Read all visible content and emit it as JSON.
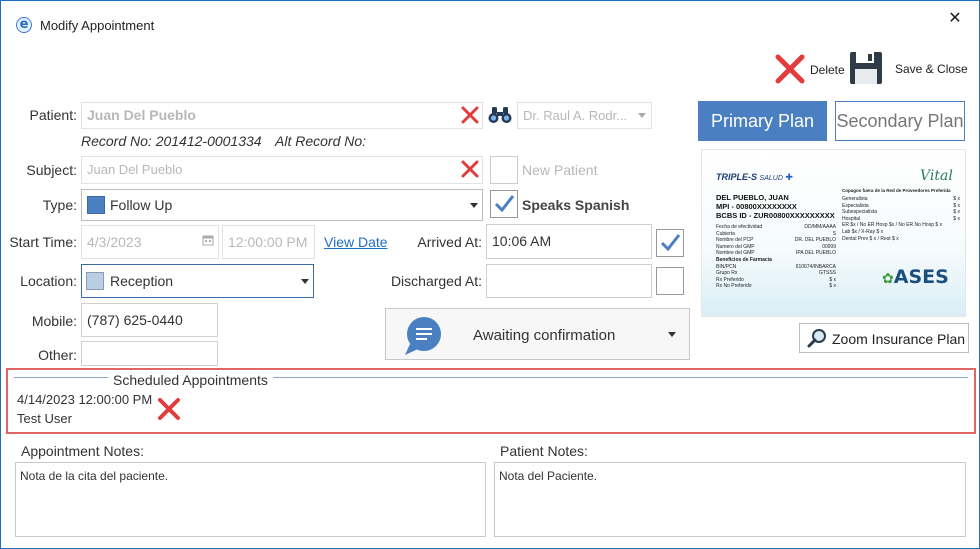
{
  "window": {
    "title": "Modify Appointment"
  },
  "toolbar": {
    "delete_label": "Delete",
    "save_close_label": "Save & Close"
  },
  "patient": {
    "label": "Patient:",
    "value": "Juan Del Pueblo",
    "record_no": "Record No: 201412-0001334",
    "alt_record_no": "Alt Record No:",
    "doctor": "Dr. Raul A. Rodr..."
  },
  "subject": {
    "label": "Subject:",
    "value": "Juan Del Pueblo",
    "new_patient_label": "New Patient"
  },
  "type": {
    "label": "Type:",
    "value": "Follow Up",
    "color": "#4a7fc1",
    "speaks_spanish_label": "Speaks Spanish"
  },
  "start_time": {
    "label": "Start Time:",
    "date": "4/3/2023",
    "time": "12:00:00 PM",
    "view_date_label": "View Date",
    "arrived_label": "Arrived At:",
    "arrived_value": "10:06 AM"
  },
  "location": {
    "label": "Location:",
    "value": "Reception",
    "color": "#b9cde3",
    "discharged_label": "Discharged At:",
    "discharged_value": ""
  },
  "mobile": {
    "label": "Mobile:",
    "value": "(787) 625-0440"
  },
  "other": {
    "label": "Other:",
    "value": ""
  },
  "status": {
    "label": "Awaiting confirmation",
    "icon": "chat-bubble-icon"
  },
  "plans": {
    "primary_label": "Primary Plan",
    "secondary_label": "Secondary Plan",
    "zoom_label": "Zoom Insurance Plan",
    "accent": "#4a7fc1"
  },
  "insurance_card": {
    "brand": "TRIPLE-S",
    "brand_suffix": "SALUD",
    "vital": "Vital",
    "name": "DEL PUEBLO, JUAN",
    "mpi": "MPI - 00800XXXXXXXX",
    "bcbs": "BCBS ID - ZUR00800XXXXXXXXX",
    "rows_left": [
      [
        "Fecha de efectividad",
        "DD/MM/AAAA"
      ],
      [
        "Cubierta",
        "S"
      ],
      [
        "Nombre del PCP",
        "DR. DEL PUEBLO"
      ],
      [
        "Numero del GMP",
        "00999"
      ],
      [
        "Nombre del GMP",
        "IPA DEL PUEBLO"
      ],
      [
        "Beneficios de Farmacia",
        ""
      ],
      [
        "BIN/PCN",
        "610674/INBARCA"
      ],
      [
        "Grupo Rx",
        "GTSSS"
      ],
      [
        "Rx Preferido",
        "$ x"
      ],
      [
        "Rx No Preferido",
        "$ x"
      ]
    ],
    "copay_title": "Copagos fuera de la Red de Proveedores Preferida",
    "rows_right": [
      [
        "Generalista",
        "$ x"
      ],
      [
        "Especialista",
        "$ x"
      ],
      [
        "Subespecialista",
        "$ x"
      ],
      [
        "Hospital",
        "$ x"
      ],
      [
        "ER $x / No ER Hosp $x / No ER No Hosp $ x",
        ""
      ],
      [
        "Lab $x / X-Ray $ x",
        ""
      ],
      [
        "Dental Prev $ x / Rest $ x",
        ""
      ]
    ],
    "ases": "ASES"
  },
  "scheduled": {
    "title": "Scheduled Appointments",
    "items": [
      {
        "datetime": "4/14/2023 12:00:00 PM",
        "user": "Test User"
      }
    ]
  },
  "appointment_notes": {
    "label": "Appointment Notes:",
    "value": "Nota de la cita del paciente."
  },
  "patient_notes": {
    "label": "Patient Notes:",
    "value": "Nota del Paciente."
  }
}
